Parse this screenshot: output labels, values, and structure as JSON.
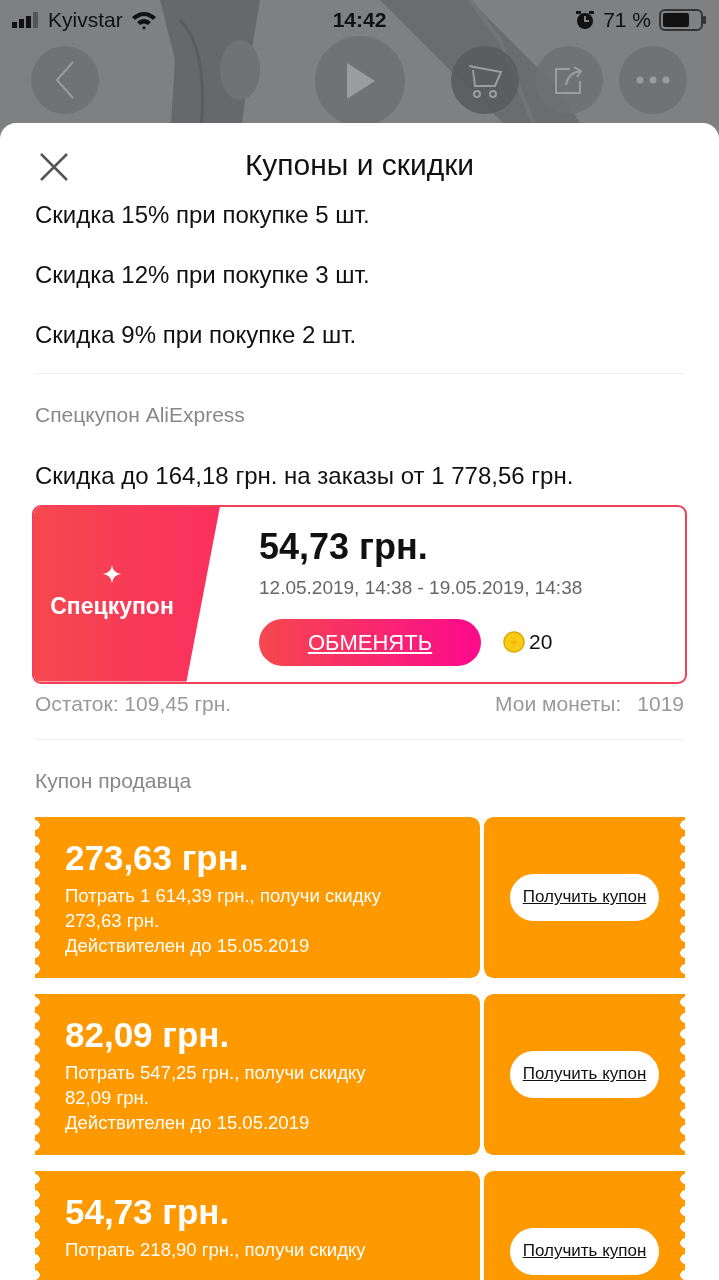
{
  "status_bar": {
    "carrier": "Kyivstar",
    "time": "14:42",
    "battery": "71 %"
  },
  "sheet": {
    "title": "Купоны и скидки",
    "discount_tiers": [
      "Скидка 15% при покупке 5 шт.",
      "Скидка 12% при покупке 3 шт.",
      "Скидка 9% при покупке 2 шт."
    ],
    "special": {
      "heading": "Спецкупон AliExpress",
      "description": "Скидка до 164,18 грн. на заказы от 1 778,56 грн.",
      "coupon": {
        "badge": "Спецкупон",
        "amount": "54,73 грн.",
        "period": "12.05.2019, 14:38 - 19.05.2019, 14:38",
        "button": "ОБМЕНЯТЬ",
        "coin_cost": "20"
      },
      "remaining": "Остаток: 109,45 грн.",
      "coins_label": "Мои монеты:",
      "coins_value": "1019"
    },
    "seller": {
      "heading": "Купон продавца",
      "coupons": [
        {
          "amount": "273,63 грн.",
          "description": "Потрать 1 614,39 грн., получи скидку 273,63 грн.",
          "valid": "Действителен до 15.05.2019",
          "button": "Получить купон"
        },
        {
          "amount": "82,09 грн.",
          "description": "Потрать 547,25 грн., получи скидку 82,09 грн.",
          "valid": "Действителен до 15.05.2019",
          "button": "Получить купон"
        },
        {
          "amount": "54,73 грн.",
          "description": "Потрать 218,90 грн., получи скидку",
          "button": "Получить купон"
        }
      ]
    }
  }
}
